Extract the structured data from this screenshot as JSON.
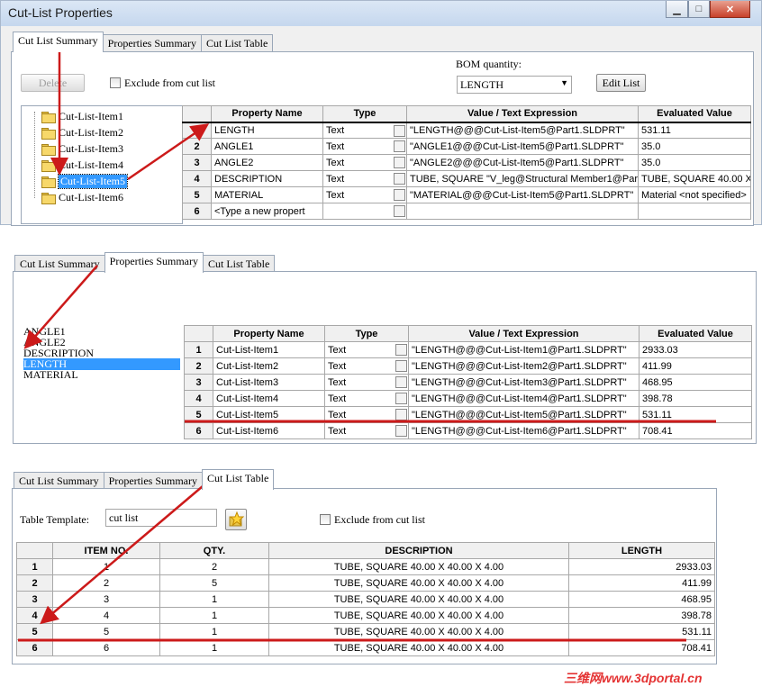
{
  "window": {
    "title": "Cut-List Properties",
    "minimize": "▁",
    "maximize": "□",
    "close": "✕"
  },
  "tabs": [
    "Cut List Summary",
    "Properties Summary",
    "Cut List Table"
  ],
  "panel1": {
    "delete_label": "Delete",
    "exclude_label": "Exclude from cut list",
    "bom_label": "BOM quantity:",
    "bom_value": "LENGTH",
    "edit_list_label": "Edit List",
    "tree_items": [
      "Cut-List-Item1",
      "Cut-List-Item2",
      "Cut-List-Item3",
      "Cut-List-Item4",
      "Cut-List-Item5",
      "Cut-List-Item6"
    ],
    "selected_tree_item": "Cut-List-Item5",
    "headers": [
      "",
      "Property Name",
      "Type",
      "Value / Text Expression",
      "Evaluated Value"
    ],
    "rows": [
      [
        "1",
        "LENGTH",
        "Text",
        "\"LENGTH@@@Cut-List-Item5@Part1.SLDPRT\"",
        "531.11"
      ],
      [
        "2",
        "ANGLE1",
        "Text",
        "\"ANGLE1@@@Cut-List-Item5@Part1.SLDPRT\"",
        "35.0"
      ],
      [
        "3",
        "ANGLE2",
        "Text",
        "\"ANGLE2@@@Cut-List-Item5@Part1.SLDPRT\"",
        "35.0"
      ],
      [
        "4",
        "DESCRIPTION",
        "Text",
        "TUBE, SQUARE \"V_leg@Structural Member1@Par",
        "TUBE, SQUARE 40.00 X"
      ],
      [
        "5",
        "MATERIAL",
        "Text",
        "\"MATERIAL@@@Cut-List-Item5@Part1.SLDPRT\"",
        "Material <not specified>"
      ],
      [
        "6",
        "<Type a new propert",
        "",
        "",
        ""
      ]
    ]
  },
  "panel2": {
    "list_items": [
      "ANGLE1",
      "ANGLE2",
      "DESCRIPTION",
      "LENGTH",
      "MATERIAL"
    ],
    "selected_item": "LENGTH",
    "headers": [
      "",
      "Property Name",
      "Type",
      "Value / Text Expression",
      "Evaluated Value"
    ],
    "rows": [
      [
        "1",
        "Cut-List-Item1",
        "Text",
        "\"LENGTH@@@Cut-List-Item1@Part1.SLDPRT\"",
        "2933.03"
      ],
      [
        "2",
        "Cut-List-Item2",
        "Text",
        "\"LENGTH@@@Cut-List-Item2@Part1.SLDPRT\"",
        "411.99"
      ],
      [
        "3",
        "Cut-List-Item3",
        "Text",
        "\"LENGTH@@@Cut-List-Item3@Part1.SLDPRT\"",
        "468.95"
      ],
      [
        "4",
        "Cut-List-Item4",
        "Text",
        "\"LENGTH@@@Cut-List-Item4@Part1.SLDPRT\"",
        "398.78"
      ],
      [
        "5",
        "Cut-List-Item5",
        "Text",
        "\"LENGTH@@@Cut-List-Item5@Part1.SLDPRT\"",
        "531.11"
      ],
      [
        "6",
        "Cut-List-Item6",
        "Text",
        "\"LENGTH@@@Cut-List-Item6@Part1.SLDPRT\"",
        "708.41"
      ]
    ]
  },
  "panel3": {
    "template_label": "Table Template:",
    "template_value": "cut list",
    "exclude_label": "Exclude from cut list",
    "headers": [
      "",
      "ITEM NO.",
      "QTY.",
      "DESCRIPTION",
      "LENGTH"
    ],
    "rows": [
      [
        "1",
        "1",
        "2",
        "TUBE, SQUARE 40.00 X 40.00 X 4.00",
        "2933.03"
      ],
      [
        "2",
        "2",
        "5",
        "TUBE, SQUARE 40.00 X 40.00 X 4.00",
        "411.99"
      ],
      [
        "3",
        "3",
        "1",
        "TUBE, SQUARE 40.00 X 40.00 X 4.00",
        "468.95"
      ],
      [
        "4",
        "4",
        "1",
        "TUBE, SQUARE 40.00 X 40.00 X 4.00",
        "398.78"
      ],
      [
        "5",
        "5",
        "1",
        "TUBE, SQUARE 40.00 X 40.00 X 4.00",
        "531.11"
      ],
      [
        "6",
        "6",
        "1",
        "TUBE, SQUARE 40.00 X 40.00 X 4.00",
        "708.41"
      ]
    ]
  },
  "watermark": "三维网www.3dportal.cn",
  "colors": {
    "selection": "#3399ff",
    "arrow": "#cc1a1a",
    "watermark": "#e43333"
  }
}
